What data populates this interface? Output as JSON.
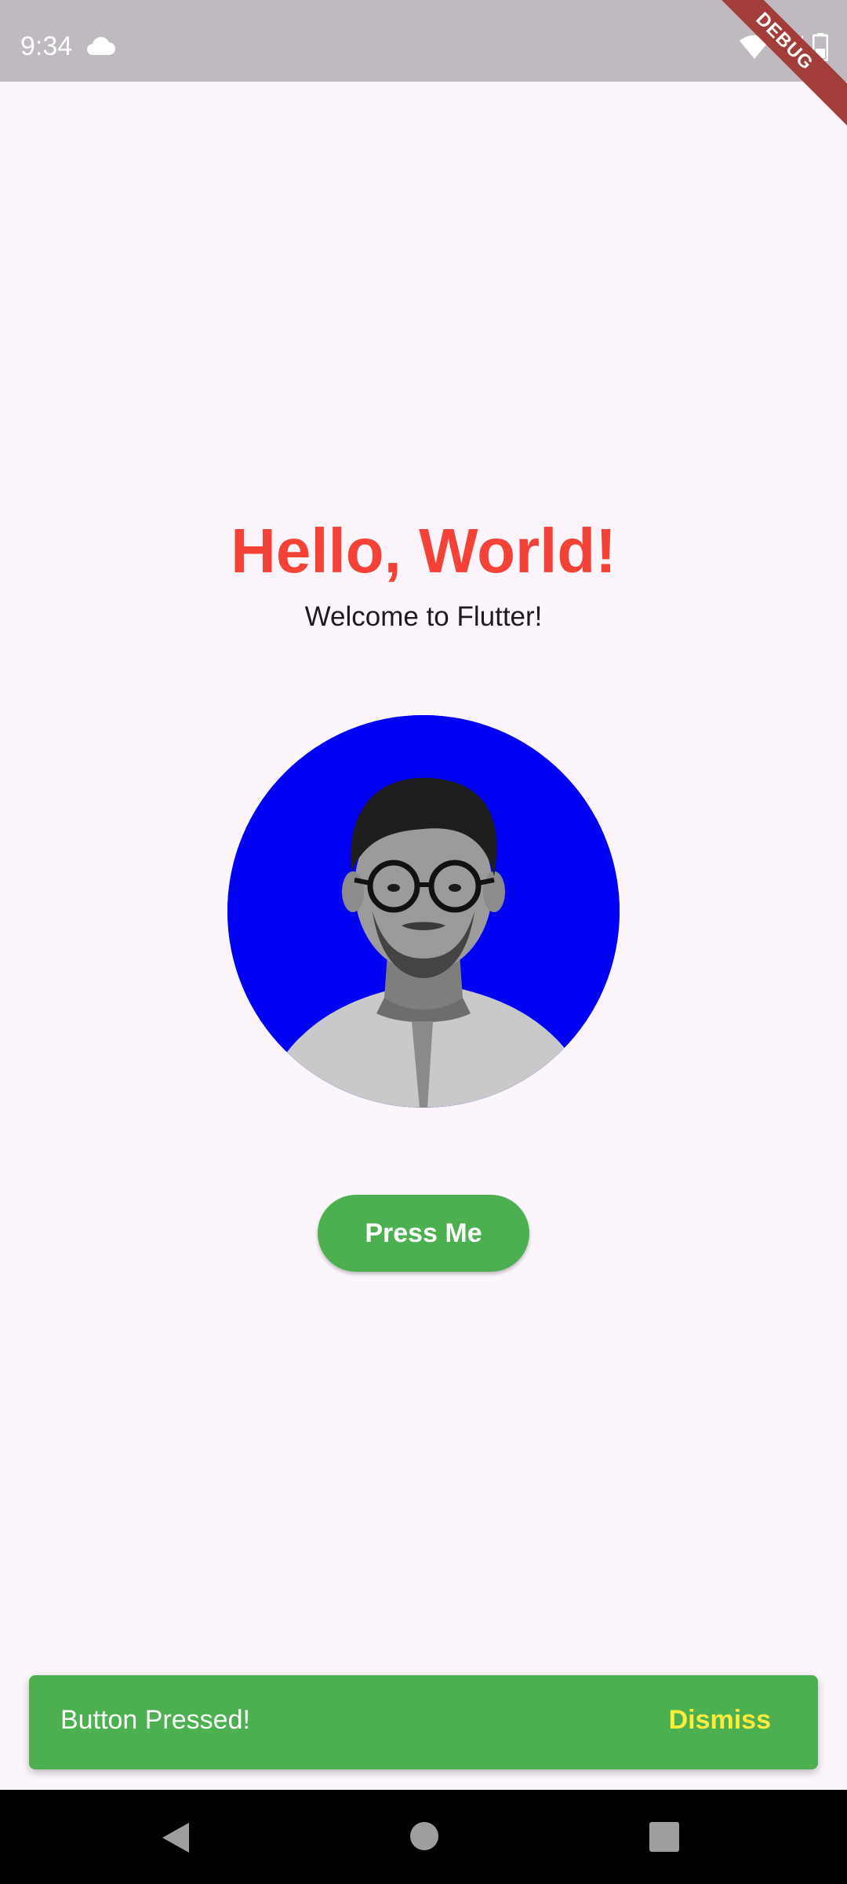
{
  "status_bar": {
    "time": "9:34",
    "icons": [
      "cloud-icon",
      "wifi-icon",
      "signal-icon",
      "battery-icon"
    ]
  },
  "debug_banner": {
    "label": "DEBUG"
  },
  "main": {
    "title": "Hello, World!",
    "subtitle": "Welcome to Flutter!",
    "avatar": {
      "icon": "profile-photo",
      "background": "#0000f5"
    },
    "button_label": "Press Me"
  },
  "snackbar": {
    "message": "Button Pressed!",
    "action_label": "Dismiss"
  },
  "nav_bar": {
    "icons": [
      "back-icon",
      "home-icon",
      "recents-icon"
    ]
  },
  "colors": {
    "title": "#f44336",
    "button": "#4caf50",
    "snackbar": "#4caf50",
    "snackbar_action": "#ffeb3b",
    "background": "#fcf6fc",
    "status_bar": "#bebabf"
  }
}
